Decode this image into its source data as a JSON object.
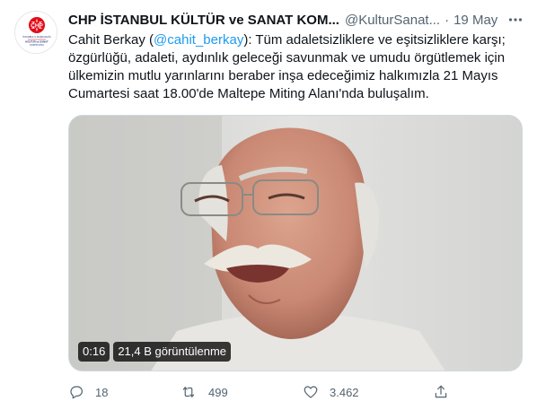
{
  "tweet": {
    "author_name": "CHP İSTANBUL KÜLTÜR ve SANAT KOM...",
    "author_handle": "@KulturSanat...",
    "separator": "·",
    "date": "19 May",
    "text": {
      "prefix": "Cahit Berkay (",
      "mention": "@cahit_berkay",
      "suffix": "): Tüm adaletsizliklere ve eşitsizliklere karşı; özgürlüğü, adaleti, aydınlık geleceği savunmak ve umudu örgütlemek için ülkemizin mutlu yarınlarını beraber inşa edeceğimiz halkımızla 21 Mayıs Cumartesi saat 18.00'de Maltepe Miting Alanı'nda buluşalım."
    },
    "avatar": {
      "logo_text": "CHP",
      "line1": "İSTANBUL İL BAŞKANLIĞI",
      "line2": "KÜLTÜR ve SANAT",
      "line3": "KOMİSYONU"
    },
    "video": {
      "duration": "0:16",
      "views": "21,4 B görüntülenme"
    },
    "actions": {
      "reply_count": "18",
      "retweet_count": "499",
      "like_count": "3.462",
      "share_icon": "share-icon"
    }
  },
  "colors": {
    "text": "#0f1419",
    "secondary": "#536471",
    "link": "#1d9bf0",
    "brand_red": "#e30a17"
  }
}
